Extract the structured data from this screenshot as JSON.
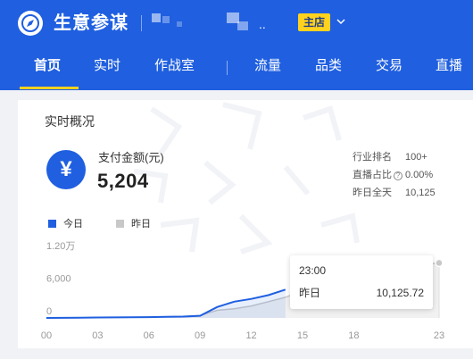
{
  "header": {
    "app_name": "生意参谋",
    "shop_badge": "主店",
    "shop_name_suffix": "..",
    "colors": {
      "bar": "#1f5fe0",
      "accent": "#ffd21e"
    },
    "icons": [
      "compass-logo-icon",
      "chevron-down-icon"
    ]
  },
  "nav": {
    "items": [
      {
        "label": "首页",
        "active": true
      },
      {
        "label": "实时",
        "active": false
      },
      {
        "label": "作战室",
        "active": false
      },
      {
        "label": "流量",
        "active": false
      },
      {
        "label": "品类",
        "active": false
      },
      {
        "label": "交易",
        "active": false
      },
      {
        "label": "直播",
        "active": false
      }
    ]
  },
  "realtime": {
    "title": "实时概况",
    "metric": {
      "icon": "yuan-icon",
      "icon_glyph": "¥",
      "label": "支付金额(元)",
      "value": "5,204"
    },
    "stats": [
      {
        "label": "行业排名",
        "value": "100+"
      },
      {
        "label": "直播占比",
        "value": "0.00%",
        "help_icon": "question-circle-icon"
      },
      {
        "label": "昨日全天",
        "value": "10,125"
      }
    ],
    "legend": [
      {
        "label": "今日",
        "color": "#1f5fe0"
      },
      {
        "label": "昨日",
        "color": "#c8c8c8"
      }
    ],
    "tooltip": {
      "time": "23:00",
      "label": "昨日",
      "value": "10,125.72"
    }
  },
  "chart_data": {
    "type": "area",
    "title": "",
    "xlabel": "",
    "ylabel": "",
    "x_ticks": [
      "00",
      "03",
      "06",
      "09",
      "12",
      "15",
      "18",
      "23"
    ],
    "y_ticks": [
      "0",
      "6,000",
      "1.20万"
    ],
    "ylim": [
      0,
      12000
    ],
    "xlim": [
      0,
      23
    ],
    "grid": false,
    "series": [
      {
        "name": "今日",
        "color": "#1f5fe0",
        "x": [
          0,
          1,
          2,
          3,
          4,
          5,
          6,
          7,
          8,
          9,
          10,
          11,
          12,
          13,
          14
        ],
        "y": [
          0,
          20,
          50,
          80,
          100,
          120,
          140,
          200,
          250,
          400,
          2000,
          3000,
          3500,
          4200,
          5204
        ]
      },
      {
        "name": "昨日",
        "color": "#c8c8c8",
        "x": [
          0,
          1,
          2,
          3,
          4,
          5,
          6,
          7,
          8,
          9,
          10,
          11,
          12,
          13,
          14,
          15,
          16,
          17,
          18,
          19,
          20,
          21,
          22,
          23
        ],
        "y": [
          0,
          20,
          50,
          80,
          100,
          120,
          150,
          200,
          260,
          450,
          1400,
          1700,
          2200,
          3000,
          3800,
          5000,
          6000,
          6800,
          7500,
          8200,
          8800,
          9300,
          9800,
          10125.72
        ]
      }
    ],
    "highlight": {
      "x": 23,
      "series": "昨日"
    }
  }
}
